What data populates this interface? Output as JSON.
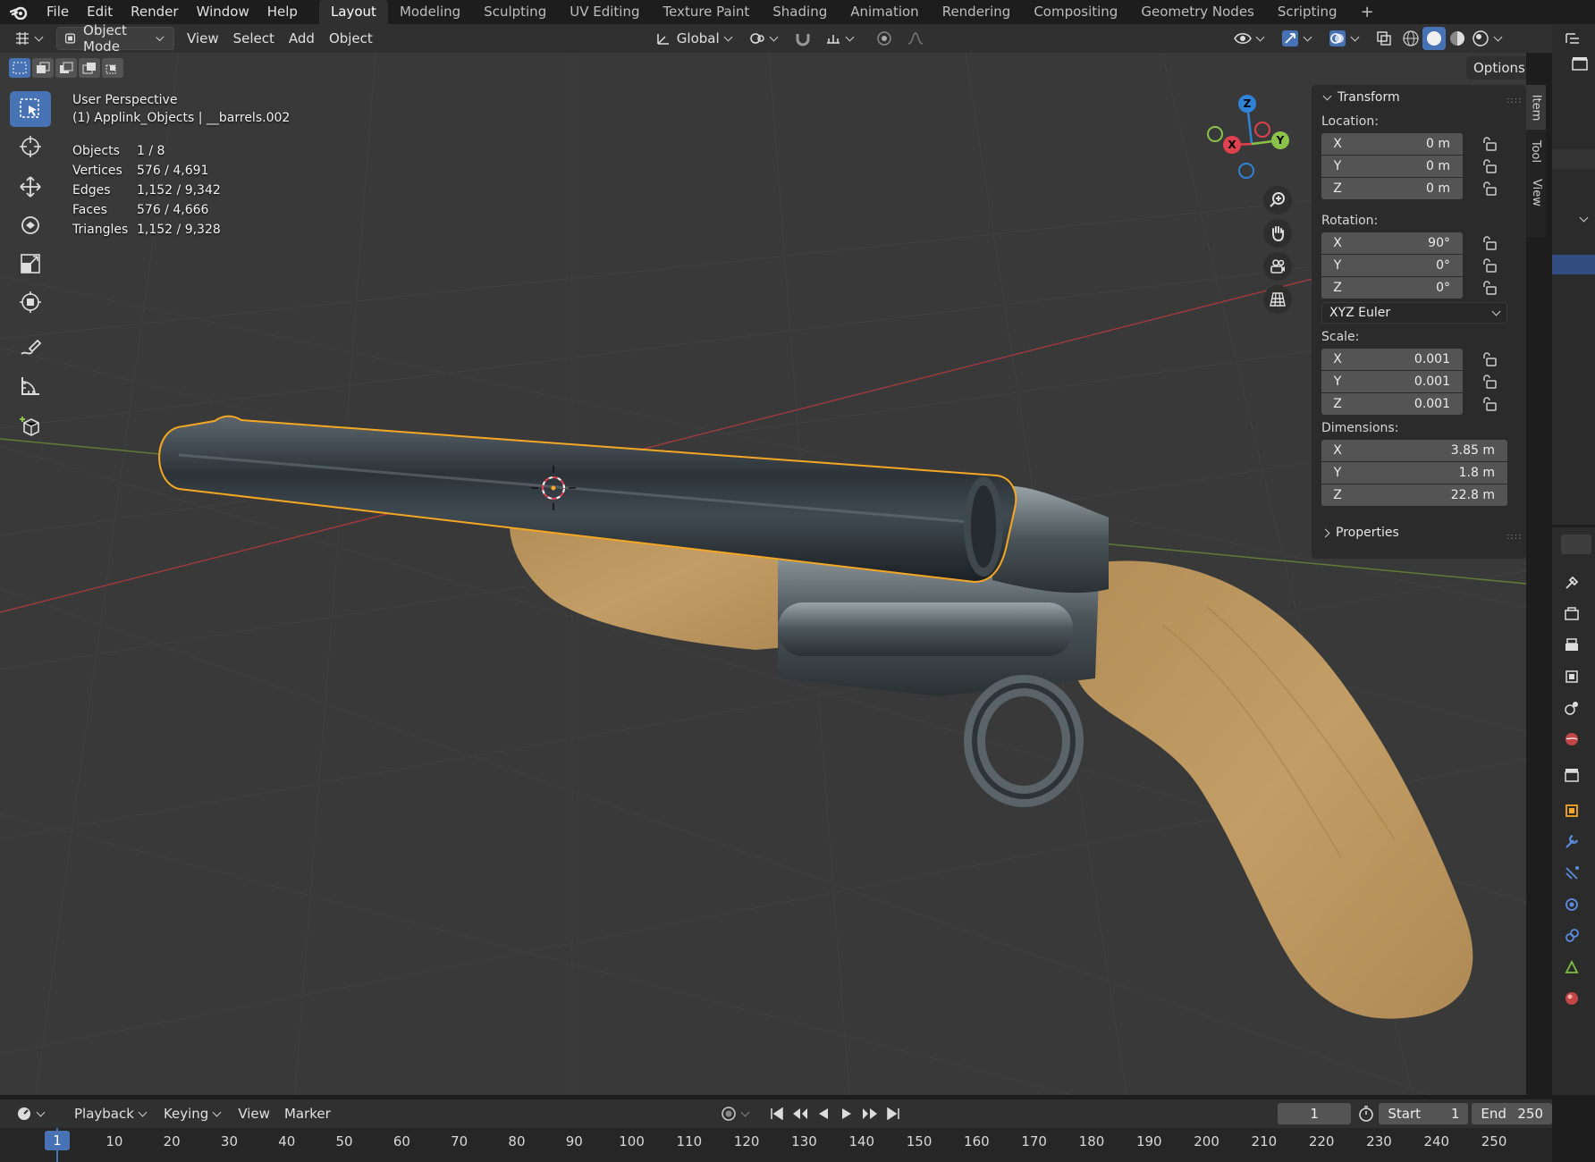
{
  "menu": {
    "items": [
      "File",
      "Edit",
      "Render",
      "Window",
      "Help"
    ]
  },
  "workspaces": {
    "tabs": [
      "Layout",
      "Modeling",
      "Sculpting",
      "UV Editing",
      "Texture Paint",
      "Shading",
      "Animation",
      "Rendering",
      "Compositing",
      "Geometry Nodes",
      "Scripting"
    ],
    "active": "Layout",
    "add": "+"
  },
  "header": {
    "mode": "Object Mode",
    "view": "View",
    "select": "Select",
    "add": "Add",
    "object": "Object",
    "orientation": "Global",
    "options": "Options"
  },
  "viewport": {
    "perspective": "User Perspective",
    "collection": "(1) Applink_Objects | __barrels.002",
    "stats": [
      {
        "label": "Objects",
        "value": "1 / 8"
      },
      {
        "label": "Vertices",
        "value": "576 / 4,691"
      },
      {
        "label": "Edges",
        "value": "1,152 / 9,342"
      },
      {
        "label": "Faces",
        "value": "576 / 4,666"
      },
      {
        "label": "Triangles",
        "value": "1,152 / 9,328"
      }
    ],
    "gizmo": {
      "x": "X",
      "y": "Y",
      "z": "Z"
    }
  },
  "npanel": {
    "transform_title": "Transform",
    "location_label": "Location:",
    "location": [
      {
        "axis": "X",
        "value": "0 m"
      },
      {
        "axis": "Y",
        "value": "0 m"
      },
      {
        "axis": "Z",
        "value": "0 m"
      }
    ],
    "rotation_label": "Rotation:",
    "rotation": [
      {
        "axis": "X",
        "value": "90°"
      },
      {
        "axis": "Y",
        "value": "0°"
      },
      {
        "axis": "Z",
        "value": "0°"
      }
    ],
    "rotation_mode": "XYZ Euler",
    "scale_label": "Scale:",
    "scale": [
      {
        "axis": "X",
        "value": "0.001"
      },
      {
        "axis": "Y",
        "value": "0.001"
      },
      {
        "axis": "Z",
        "value": "0.001"
      }
    ],
    "dimensions_label": "Dimensions:",
    "dimensions": [
      {
        "axis": "X",
        "value": "3.85 m"
      },
      {
        "axis": "Y",
        "value": "1.8 m"
      },
      {
        "axis": "Z",
        "value": "22.8 m"
      }
    ],
    "properties_title": "Properties",
    "tabs": [
      "Item",
      "Tool",
      "View"
    ]
  },
  "timeline": {
    "playback": "Playback",
    "keying": "Keying",
    "view": "View",
    "marker": "Marker",
    "current_frame": "1",
    "start_label": "Start",
    "start": "1",
    "end_label": "End",
    "end": "250",
    "ticks": [
      "1",
      "10",
      "20",
      "30",
      "40",
      "50",
      "60",
      "70",
      "80",
      "90",
      "100",
      "110",
      "120",
      "130",
      "140",
      "150",
      "160",
      "170",
      "180",
      "190",
      "200",
      "210",
      "220",
      "230",
      "240",
      "250"
    ]
  },
  "colors": {
    "accent": "#4772b3",
    "selection": "#f5a623",
    "wood": "#c19a62",
    "axis_x": "#e0414f",
    "axis_y": "#8bc34a",
    "axis_z": "#2f83d6"
  }
}
